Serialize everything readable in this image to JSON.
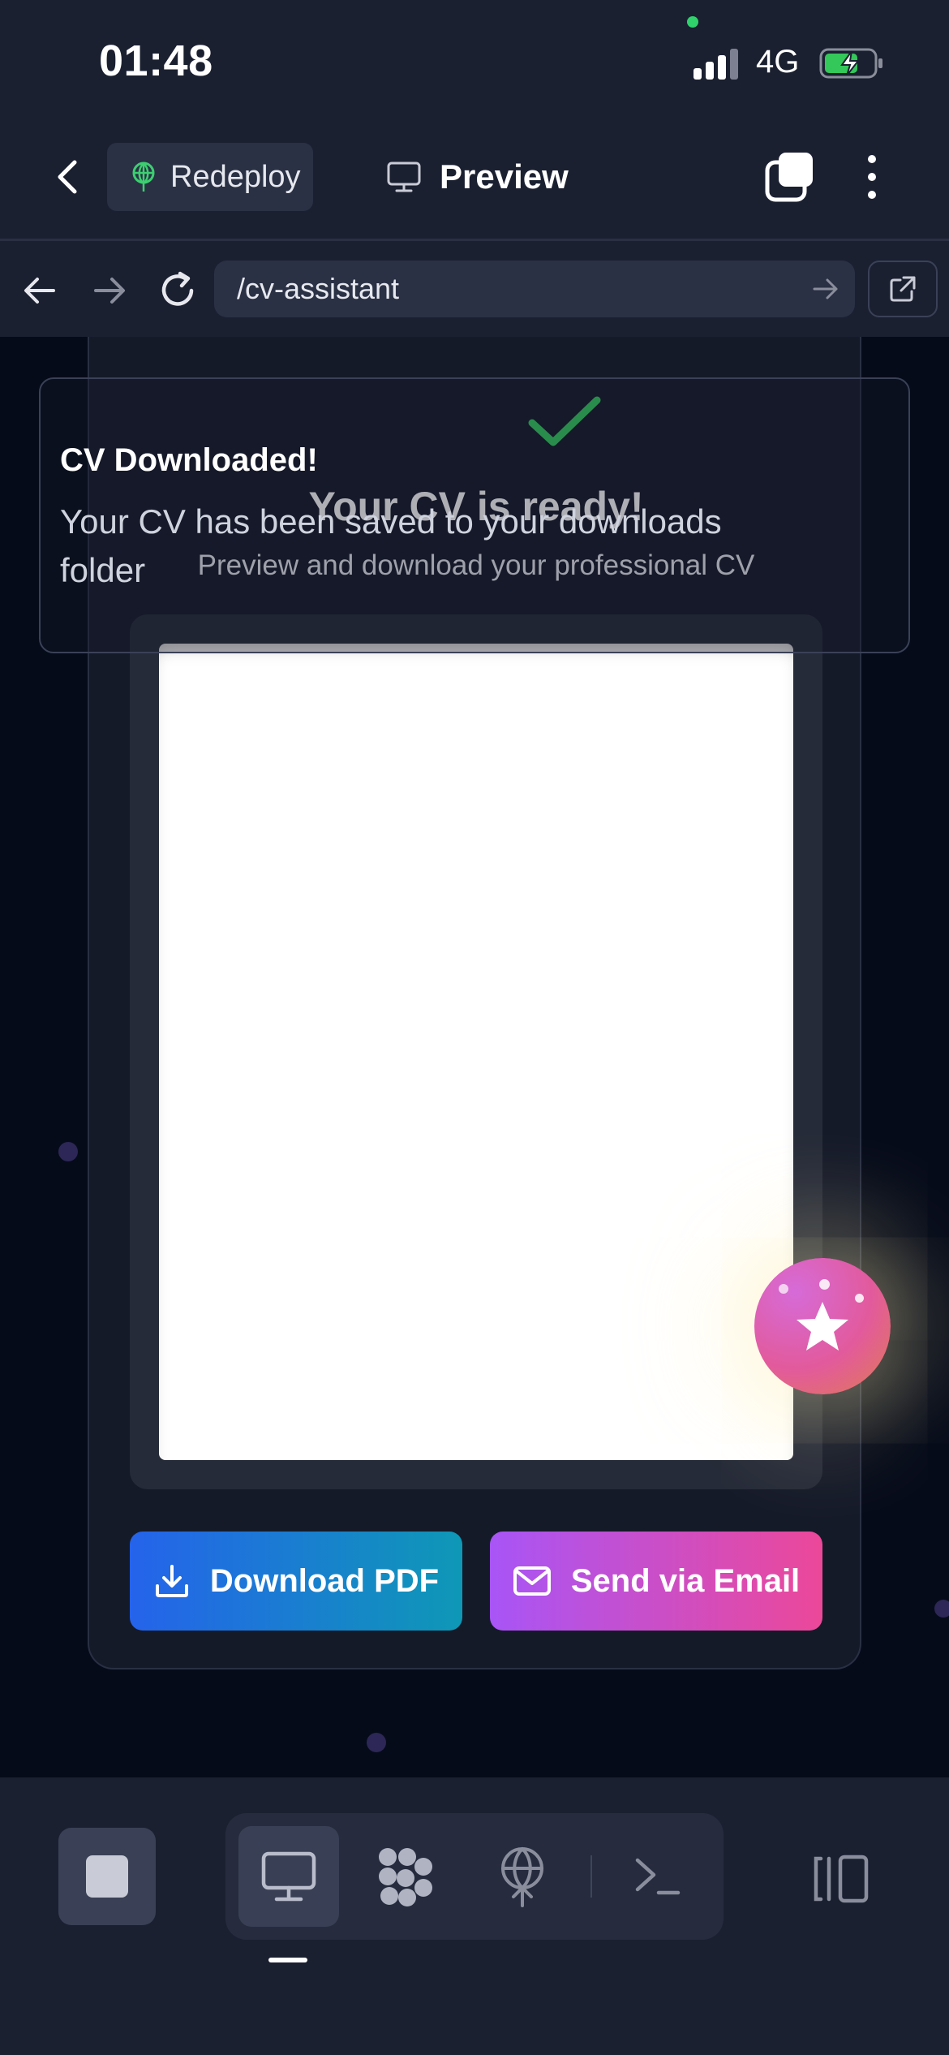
{
  "status_bar": {
    "time": "01:48",
    "network": "4G",
    "icons": [
      "signal-icon",
      "battery-charging-icon"
    ]
  },
  "header": {
    "redeploy_label": "Redeploy",
    "preview_label": "Preview",
    "icons": [
      "back-icon",
      "redeploy-icon",
      "monitor-icon",
      "tabs-icon",
      "more-icon"
    ]
  },
  "urlbar": {
    "url": "/cv-assistant",
    "icons": [
      "nav-back-icon",
      "nav-forward-icon",
      "reload-icon",
      "go-arrow-icon",
      "external-link-icon"
    ]
  },
  "card": {
    "title": "Your CV is ready!",
    "subtitle": "Preview and download your professional CV",
    "download_button": "Download PDF",
    "email_button": "Send via Email"
  },
  "toast": {
    "title": "CV Downloaded!",
    "message": "Your CV has been saved to your downloads folder"
  },
  "bottom_bar": {
    "tabs": [
      "stop",
      "preview",
      "agents",
      "deploy",
      "terminal",
      "panels"
    ]
  },
  "colors": {
    "background": "#060b1a",
    "chrome": "#1b2031",
    "success_check": "#35c95e",
    "pdf_gradient": [
      "#2563eb",
      "#0e98b6"
    ],
    "email_gradient": [
      "#a855f7",
      "#ec4899"
    ]
  }
}
